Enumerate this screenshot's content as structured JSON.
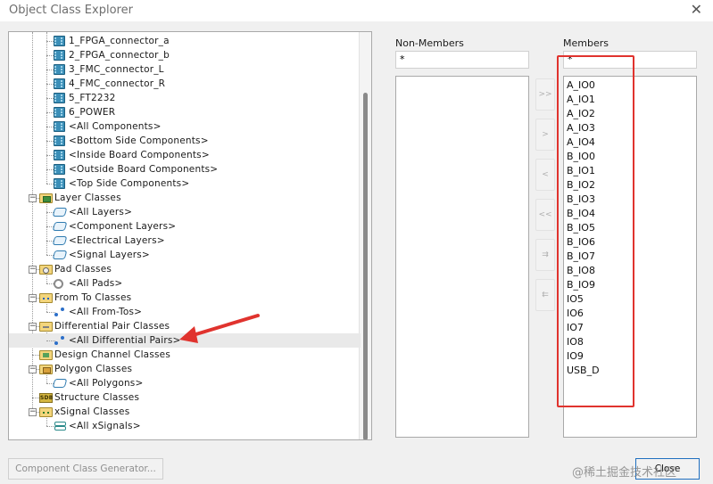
{
  "window": {
    "title": "Object Class Explorer",
    "close_glyph": "✕"
  },
  "tree": {
    "rows": [
      {
        "label": "1_FPGA_connector_a",
        "icon": "component-icon"
      },
      {
        "label": "2_FPGA_connector_b",
        "icon": "component-icon"
      },
      {
        "label": "3_FMC_connector_L",
        "icon": "component-icon"
      },
      {
        "label": "4_FMC_connector_R",
        "icon": "component-icon"
      },
      {
        "label": "5_FT2232",
        "icon": "component-icon"
      },
      {
        "label": "6_POWER",
        "icon": "component-icon"
      },
      {
        "label": "<All Components>",
        "icon": "component-icon"
      },
      {
        "label": "<Bottom Side Components>",
        "icon": "component-icon"
      },
      {
        "label": "<Inside Board Components>",
        "icon": "component-icon"
      },
      {
        "label": "<Outside Board Components>",
        "icon": "component-icon"
      },
      {
        "label": "<Top Side Components>",
        "icon": "component-icon"
      },
      {
        "label": "Layer Classes",
        "icon": "layer-folder-icon"
      },
      {
        "label": "<All Layers>",
        "icon": "layer-icon"
      },
      {
        "label": "<Component Layers>",
        "icon": "layer-icon"
      },
      {
        "label": "<Electrical Layers>",
        "icon": "layer-icon"
      },
      {
        "label": "<Signal Layers>",
        "icon": "layer-icon"
      },
      {
        "label": "Pad Classes",
        "icon": "pad-folder-icon"
      },
      {
        "label": "<All Pads>",
        "icon": "pad-icon"
      },
      {
        "label": "From To Classes",
        "icon": "fromto-folder-icon"
      },
      {
        "label": "<All From-Tos>",
        "icon": "fromto-icon"
      },
      {
        "label": "Differential Pair Classes",
        "icon": "diffpair-folder-icon"
      },
      {
        "label": "<All Differential Pairs>",
        "icon": "diffpair-icon"
      },
      {
        "label": "Design Channel Classes",
        "icon": "design-channel-folder-icon"
      },
      {
        "label": "Polygon Classes",
        "icon": "polygon-folder-icon"
      },
      {
        "label": "<All Polygons>",
        "icon": "polygon-icon"
      },
      {
        "label": "Structure Classes",
        "icon": "structure-icon"
      },
      {
        "label": "xSignal Classes",
        "icon": "xsignal-folder-icon"
      },
      {
        "label": "<All xSignals>",
        "icon": "xsignal-icon"
      }
    ],
    "expander_minus": "−",
    "struct_badge": "SDB"
  },
  "non_members": {
    "label": "Non-Members",
    "filter": "*"
  },
  "members": {
    "label": "Members",
    "filter": "*",
    "items": [
      "A_IO0",
      "A_IO1",
      "A_IO2",
      "A_IO3",
      "A_IO4",
      "B_IO0",
      "B_IO1",
      "B_IO2",
      "B_IO3",
      "B_IO4",
      "B_IO5",
      "B_IO6",
      "B_IO7",
      "B_IO8",
      "B_IO9",
      "IO5",
      "IO6",
      "IO7",
      "IO8",
      "IO9",
      "USB_D"
    ]
  },
  "move_buttons": [
    ">>",
    ">",
    "<",
    "<<",
    "⇉",
    "⇇"
  ],
  "buttons": {
    "generator": "Component Class Generator...",
    "close": "Close"
  },
  "watermark": "@稀土掘金技术社区",
  "colors": {
    "annotation_red": "#e0332e",
    "selection_bg": "#e9e9e9"
  }
}
